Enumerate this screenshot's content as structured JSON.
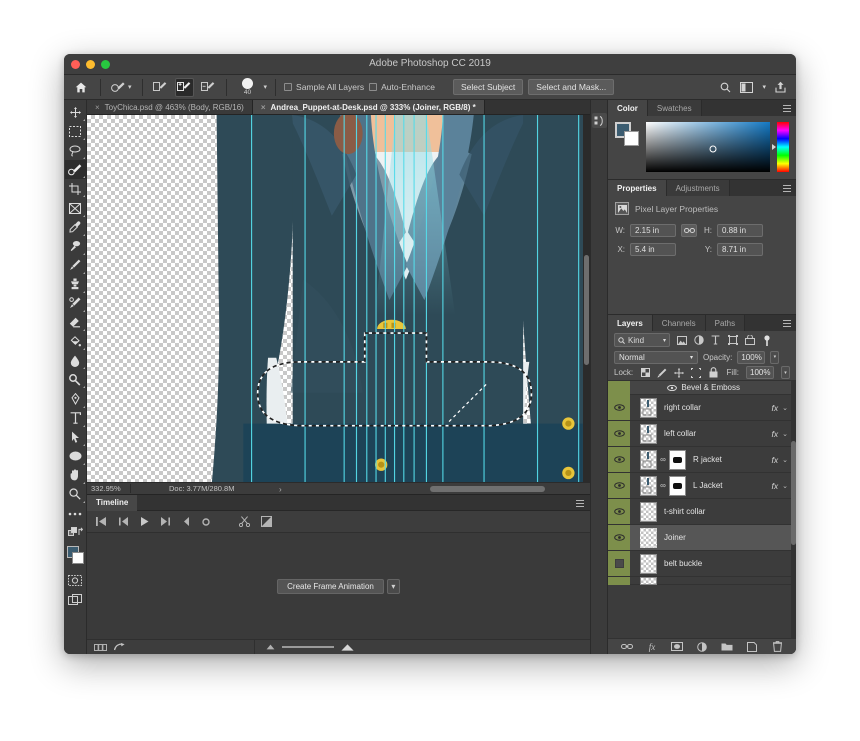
{
  "window": {
    "title": "Adobe Photoshop CC 2019",
    "traffic": [
      "close",
      "minimize",
      "zoom"
    ]
  },
  "options_bar": {
    "home_icon": "home-icon",
    "tool_preset_icon": "quick-selection-icon",
    "modes": [
      {
        "name": "new-selection",
        "icon": "brush-new-icon",
        "active": false
      },
      {
        "name": "add-to-selection",
        "icon": "brush-add-icon",
        "active": true
      },
      {
        "name": "subtract-from-selection",
        "icon": "brush-subtract-icon",
        "active": false
      }
    ],
    "brush_size": "40",
    "checkboxes": [
      {
        "label": "Sample All Layers",
        "checked": false
      },
      {
        "label": "Auto-Enhance",
        "checked": false
      }
    ],
    "buttons": [
      {
        "label": "Select Subject"
      },
      {
        "label": "Select and Mask..."
      }
    ],
    "right_icons": [
      "search-icon",
      "workspace-icon",
      "chevron-down-icon",
      "share-icon"
    ]
  },
  "toolbar": {
    "tools": [
      {
        "name": "move-tool",
        "icon": "move-icon",
        "selected": false
      },
      {
        "name": "rectangular-marquee-tool",
        "icon": "marquee-icon",
        "selected": false
      },
      {
        "name": "lasso-tool",
        "icon": "lasso-icon",
        "selected": false
      },
      {
        "name": "quick-selection-tool",
        "icon": "quick-selection-icon",
        "selected": true
      },
      {
        "name": "crop-tool",
        "icon": "crop-icon",
        "selected": false
      },
      {
        "name": "frame-tool",
        "icon": "frame-icon",
        "selected": false
      },
      {
        "name": "eyedropper-tool",
        "icon": "eyedropper-icon",
        "selected": false
      },
      {
        "name": "spot-healing-brush-tool",
        "icon": "healing-icon",
        "selected": false
      },
      {
        "name": "brush-tool",
        "icon": "brush-icon",
        "selected": false
      },
      {
        "name": "clone-stamp-tool",
        "icon": "stamp-icon",
        "selected": false
      },
      {
        "name": "history-brush-tool",
        "icon": "history-brush-icon",
        "selected": false
      },
      {
        "name": "eraser-tool",
        "icon": "eraser-icon",
        "selected": false
      },
      {
        "name": "gradient-tool",
        "icon": "paint-bucket-icon",
        "selected": false
      },
      {
        "name": "blur-tool",
        "icon": "blur-drop-icon",
        "selected": false
      },
      {
        "name": "dodge-tool",
        "icon": "dodge-icon",
        "selected": false
      },
      {
        "name": "pen-tool",
        "icon": "pen-icon",
        "selected": false
      },
      {
        "name": "type-tool",
        "icon": "type-icon",
        "selected": false
      },
      {
        "name": "path-selection-tool",
        "icon": "path-arrow-icon",
        "selected": false
      },
      {
        "name": "ellipse-tool",
        "icon": "ellipse-icon",
        "selected": false
      },
      {
        "name": "hand-tool",
        "icon": "hand-icon",
        "selected": false
      },
      {
        "name": "zoom-tool",
        "icon": "magnifier-icon",
        "selected": false
      },
      {
        "name": "edit-toolbar",
        "icon": "ellipsis-icon",
        "selected": false
      }
    ],
    "swap_icon": "swap-colors-icon",
    "default_icon": "default-colors-icon",
    "foreground_color": "#3b5c70",
    "background_color": "#ffffff",
    "quickmask_icon": "quick-mask-icon",
    "screenmode_icon": "screen-mode-icon"
  },
  "tabs": [
    {
      "label": "ToyChica.psd @ 463% (Body, RGB/16)",
      "active": false,
      "close": "×"
    },
    {
      "label": "Andrea_Puppet-at-Desk.psd @ 333% (Joiner, RGB/8) *",
      "active": true,
      "close": "×"
    }
  ],
  "status_bar": {
    "zoom": "332.95%",
    "doc_info": "Doc: 3.77M/280.8M",
    "arrow": "›"
  },
  "timeline": {
    "tab_label": "Timeline",
    "controls": [
      {
        "name": "go-to-first-frame-button",
        "icon": "skip-start-icon"
      },
      {
        "name": "previous-frame-button",
        "icon": "step-back-icon"
      },
      {
        "name": "play-button",
        "icon": "play-icon"
      },
      {
        "name": "next-frame-button",
        "icon": "step-forward-icon"
      },
      {
        "name": "audio-button",
        "icon": "audio-icon"
      },
      {
        "name": "render-settings-button",
        "icon": "gear-icon"
      },
      {
        "name": "split-clip-button",
        "icon": "scissors-icon"
      },
      {
        "name": "transition-button",
        "icon": "transition-icon"
      }
    ],
    "create_frame_animation_label": "Create Frame Animation",
    "dropdown_caret": "⌄",
    "footer": {
      "frames_icon": "frames-icon",
      "convert-icon": "convert-to-video-icon",
      "zoom_out_icon": "zoom-out-icon",
      "zoom_in_icon": "zoom-in-icon"
    }
  },
  "color_panel": {
    "tabs": [
      {
        "label": "Color",
        "active": true
      },
      {
        "label": "Swatches",
        "active": false
      }
    ],
    "foreground_color": "#3b5c70",
    "background_color": "#ffffff"
  },
  "properties_panel": {
    "tabs": [
      {
        "label": "Properties",
        "active": true
      },
      {
        "label": "Adjustments",
        "active": false
      }
    ],
    "header": "Pixel Layer Properties",
    "header_icon": "pixel-layer-icon",
    "fields": [
      {
        "label": "W:",
        "value": "2.15 in"
      },
      {
        "label": "H:",
        "value": "0.88 in"
      },
      {
        "label": "X:",
        "value": "5.4 in"
      },
      {
        "label": "Y:",
        "value": "8.71 in"
      }
    ],
    "link_icon": "link-constrain-icon"
  },
  "layers_panel": {
    "tabs": [
      {
        "label": "Layers",
        "active": true
      },
      {
        "label": "Channels",
        "active": false
      },
      {
        "label": "Paths",
        "active": false
      }
    ],
    "filter": {
      "kind_label": "Kind",
      "search_icon": "search-icon",
      "caret": "⌄",
      "icons": [
        "pixel-filter-icon",
        "adjustment-filter-icon",
        "type-filter-icon",
        "shape-filter-icon",
        "smart-object-filter-icon",
        "filter-toggle-icon"
      ]
    },
    "blend_mode": "Normal",
    "blend_caret": "⌄",
    "opacity_label": "Opacity:",
    "opacity_value": "100%",
    "lock_label": "Lock:",
    "lock_icons": [
      "lock-transparent-icon",
      "lock-image-icon",
      "lock-position-icon",
      "lock-artboard-icon",
      "lock-all-icon"
    ],
    "fill_label": "Fill:",
    "fill_value": "100%",
    "effect_row": {
      "label": "Bevel & Emboss",
      "eye_icon": "eye-icon"
    },
    "layers": [
      {
        "name": "right collar",
        "visible": true,
        "has_fx": true,
        "has_mask": false,
        "selected": false
      },
      {
        "name": "left collar",
        "visible": true,
        "has_fx": true,
        "has_mask": false,
        "selected": false
      },
      {
        "name": "R jacket",
        "visible": true,
        "has_fx": true,
        "has_mask": true,
        "selected": false
      },
      {
        "name": "L Jacket",
        "visible": true,
        "has_fx": true,
        "has_mask": true,
        "selected": false
      },
      {
        "name": "t-shirt collar",
        "visible": true,
        "has_fx": false,
        "has_mask": false,
        "selected": false
      },
      {
        "name": "Joiner",
        "visible": true,
        "has_fx": false,
        "has_mask": false,
        "selected": true
      },
      {
        "name": "belt buckle",
        "visible": false,
        "has_fx": false,
        "has_mask": false,
        "selected": false
      }
    ],
    "footer_icons": [
      "link-layers-icon",
      "add-layer-style-icon",
      "add-layer-mask-icon",
      "new-adjustment-layer-icon",
      "new-group-icon",
      "new-layer-icon",
      "delete-layer-icon"
    ],
    "fx_label": "fx",
    "caret": "⌄"
  },
  "rail": {
    "collapse_icon": "collapse-panels-icon",
    "buttons": [
      {
        "name": "libraries-panel-icon"
      }
    ]
  },
  "canvas": {
    "description": "puppet figure in dark teal suit with cyan guides and active marching-ants selection",
    "colors": {
      "suit_dark": "#2e4a57",
      "suit_mid": "#3b5c70",
      "lapel": "#547b94",
      "shirt": "#e8ecee",
      "skin": "#f0c09a",
      "guide": "#55dcea",
      "button": "#e8c53a",
      "pants": "#1d4357"
    }
  }
}
